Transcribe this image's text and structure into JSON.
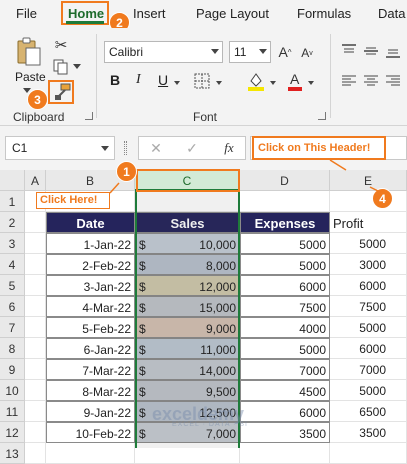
{
  "menu": {
    "tabs": [
      "File",
      "Home",
      "Insert",
      "Page Layout",
      "Formulas",
      "Data"
    ]
  },
  "ribbon": {
    "clipboard": {
      "paste_label": "Paste",
      "group_label": "Clipboard"
    },
    "font": {
      "font_name": "Calibri",
      "font_size": "11",
      "bold": "B",
      "italic": "I",
      "underline": "U",
      "group_label": "Font"
    },
    "colors": {
      "fill": "#f5e600",
      "font": "#e02020"
    }
  },
  "badges": [
    "1",
    "2",
    "3",
    "4"
  ],
  "callouts": {
    "click_here": "Click Here!",
    "click_header": "Click on This Header!"
  },
  "formula_bar": {
    "name_box": "C1",
    "fx": "fx"
  },
  "sheet": {
    "columns": [
      "A",
      "B",
      "C",
      "D",
      "E"
    ],
    "rows": [
      "1",
      "2",
      "3",
      "4",
      "5",
      "6",
      "7",
      "8",
      "9",
      "10",
      "11",
      "12",
      "13"
    ],
    "headers": {
      "date": "Date",
      "sales": "Sales",
      "expenses": "Expenses",
      "profit": "Profit"
    },
    "currency": "$",
    "data": [
      {
        "date": "1-Jan-22",
        "sales": "10,000",
        "expenses": "5000",
        "profit": "5000"
      },
      {
        "date": "2-Feb-22",
        "sales": "8,000",
        "expenses": "5000",
        "profit": "3000"
      },
      {
        "date": "3-Jan-22",
        "sales": "12,000",
        "expenses": "6000",
        "profit": "6000"
      },
      {
        "date": "4-Mar-22",
        "sales": "15,000",
        "expenses": "7500",
        "profit": "7500"
      },
      {
        "date": "5-Feb-22",
        "sales": "9,000",
        "expenses": "4000",
        "profit": "5000"
      },
      {
        "date": "6-Jan-22",
        "sales": "11,000",
        "expenses": "5000",
        "profit": "6000"
      },
      {
        "date": "7-Mar-22",
        "sales": "14,000",
        "expenses": "7000",
        "profit": "7000"
      },
      {
        "date": "8-Mar-22",
        "sales": "9,500",
        "expenses": "4500",
        "profit": "5000"
      },
      {
        "date": "9-Jan-22",
        "sales": "12,500",
        "expenses": "6000",
        "profit": "6500"
      },
      {
        "date": "10-Feb-22",
        "sales": "7,000",
        "expenses": "3500",
        "profit": "3500"
      }
    ],
    "sales_fill_colors": [
      "#c4ccd6",
      "#b8c1cc",
      "#cfc8ac",
      "#bfc4c9",
      "#d4c0b2",
      "#bcc7d2",
      "#c3c8cf",
      "#bfc4ca",
      "#b9c2cd",
      "#c6cbd2"
    ]
  },
  "watermark": {
    "name": "exceldemy",
    "tagline": "EXCEL · DATA · BI"
  }
}
